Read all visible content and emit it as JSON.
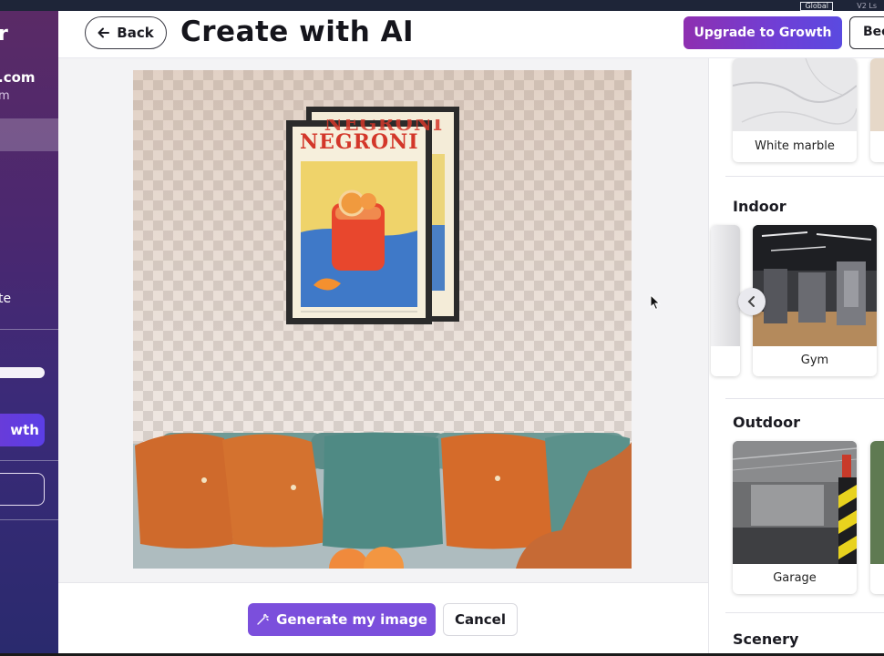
{
  "topbar": {
    "tag1": "Global",
    "tag2": "V2 Ls"
  },
  "sidebar": {
    "logo_fragment": "r",
    "email_fragment": ".com",
    "sub_fragment": "m",
    "nav_label_fragment": "te",
    "upgrade_fragment": "wth"
  },
  "header": {
    "back_label": "Back",
    "title": "Create with AI",
    "upgrade_label": "Upgrade to Growth",
    "extra_button_label": "Bee"
  },
  "canvas": {
    "poster_title": "NEGRONI",
    "poster_back_title": "NEGRONI"
  },
  "actions": {
    "generate_label": "Generate my image",
    "cancel_label": "Cancel"
  },
  "scenes": {
    "top_card": "White marble",
    "sections": [
      {
        "title": "Indoor",
        "cards": [
          "Gym"
        ]
      },
      {
        "title": "Outdoor",
        "cards": [
          "Garage"
        ]
      },
      {
        "title": "Scenery",
        "cards": []
      }
    ]
  },
  "colors": {
    "accent_purple": "#7b4fdc",
    "upgrade_gradient_start": "#8e2fb0",
    "upgrade_gradient_end": "#5a4ae0",
    "sidebar_top": "#5a2a66",
    "sidebar_bottom": "#2a2a6e"
  },
  "icons": {
    "back": "arrow-left-icon",
    "generate": "magic-wand-icon",
    "carousel_prev": "chevron-left-icon",
    "cursor": "mouse-pointer-icon"
  }
}
